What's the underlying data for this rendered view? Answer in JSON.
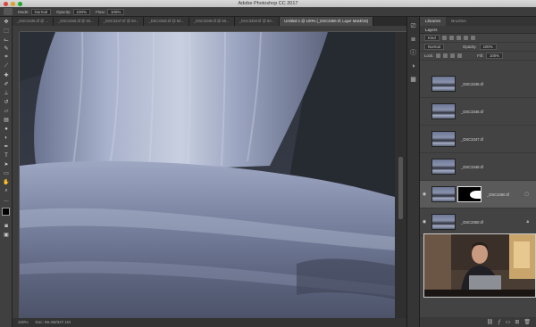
{
  "app": {
    "title": "Adobe Photoshop CC 2017"
  },
  "options_bar": {
    "mode_label": "Mode:",
    "mode_value": "Normal",
    "opacity_label": "Opacity:",
    "opacity_value": "100%",
    "flow_label": "Flow:",
    "flow_value": "100%"
  },
  "document_tabs": [
    {
      "label": "_DSC3345.tif @ ..."
    },
    {
      "label": "_DSC3346.tif @ 50..."
    },
    {
      "label": "_DSC3347.tif @ 50..."
    },
    {
      "label": "_DSC3348.tif @ 50..."
    },
    {
      "label": "_DSC3349.tif @ 50..."
    },
    {
      "label": "_DSC3350.tif @ 50..."
    },
    {
      "label": "Untitled-1 @ 100% (_DSC3350.tif, Layer Mask/16)"
    }
  ],
  "status_bar": {
    "zoom": "100%",
    "doc": "Doc: 69.4M/347.1M"
  },
  "panel": {
    "tabs": [
      "Libraries",
      "Brushes"
    ],
    "layers_title": "Layers",
    "filter_label": "Kind",
    "blend_mode": "Normal",
    "opacity_label": "Opacity:",
    "opacity_value": "100%",
    "lock_label": "Lock:",
    "fill_label": "Fill:",
    "fill_value": "100%"
  },
  "layers": [
    {
      "name": "_DSC3345.tif",
      "visible": false,
      "selected": false,
      "mask": false
    },
    {
      "name": "_DSC3346.tif",
      "visible": false,
      "selected": false,
      "mask": false
    },
    {
      "name": "_DSC3347.tif",
      "visible": false,
      "selected": false,
      "mask": false
    },
    {
      "name": "_DSC3348.tif",
      "visible": false,
      "selected": false,
      "mask": false
    },
    {
      "name": "_DSC3350.tif",
      "visible": true,
      "selected": true,
      "mask": true
    },
    {
      "name": "_DSC3350.tif",
      "visible": true,
      "selected": false,
      "mask": false
    }
  ],
  "icons": {
    "eye": "eye-icon",
    "lock": "lock-icon",
    "new_layer": "new-layer-icon",
    "trash": "trash-icon",
    "folder": "folder-icon"
  }
}
